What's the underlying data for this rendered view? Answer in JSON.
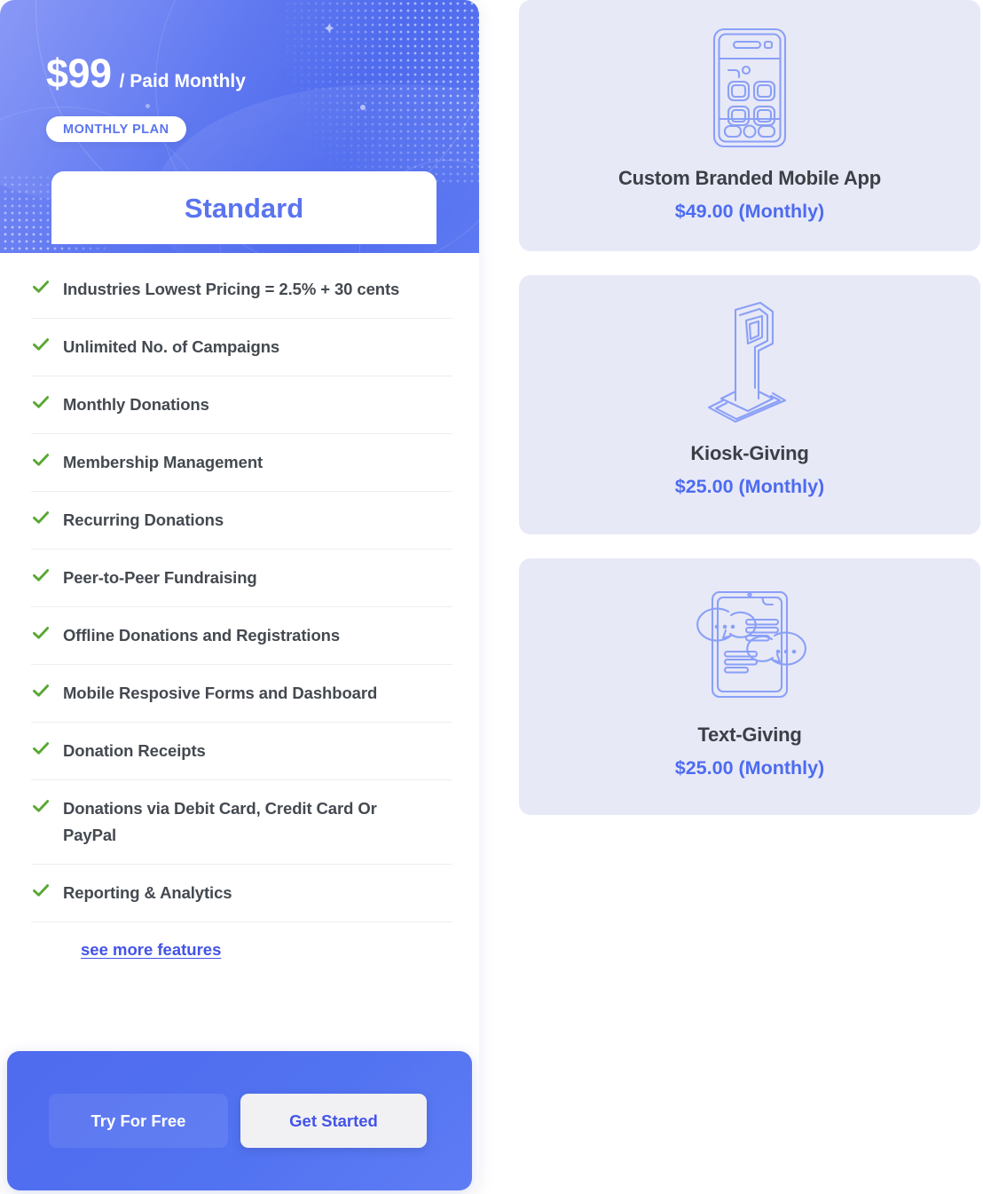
{
  "plan": {
    "price_amount": "$99",
    "price_period": "/ Paid Monthly",
    "badge": "MONTHLY PLAN",
    "title": "Standard",
    "features": [
      "Industries Lowest Pricing = 2.5% + 30 cents",
      "Unlimited No. of Campaigns",
      "Monthly Donations",
      "Membership Management",
      "Recurring Donations",
      "Peer-to-Peer Fundraising",
      "Offline Donations and Registrations",
      "Mobile Resposive Forms and Dashboard",
      "Donation Receipts",
      "Donations via Debit Card, Credit Card Or PayPal",
      "Reporting & Analytics"
    ],
    "see_more_label": "see more features",
    "buttons": {
      "try_free": "Try For Free",
      "get_started": "Get Started"
    }
  },
  "addons": [
    {
      "icon": "mobile-phone-icon",
      "name": "Custom Branded Mobile App",
      "price": "$49.00 (Monthly)"
    },
    {
      "icon": "kiosk-terminal-icon",
      "name": "Kiosk-Giving",
      "price": "$25.00 (Monthly)"
    },
    {
      "icon": "phone-chat-bubbles-icon",
      "name": "Text-Giving",
      "price": "$25.00 (Monthly)"
    }
  ],
  "colors": {
    "brand_blue": "#5a74f0",
    "link_blue": "#4353e8",
    "price_blue": "#4c6bf0",
    "check_green": "#5aa832",
    "addon_card_bg": "#e8e9f7",
    "feature_text": "#444950"
  }
}
